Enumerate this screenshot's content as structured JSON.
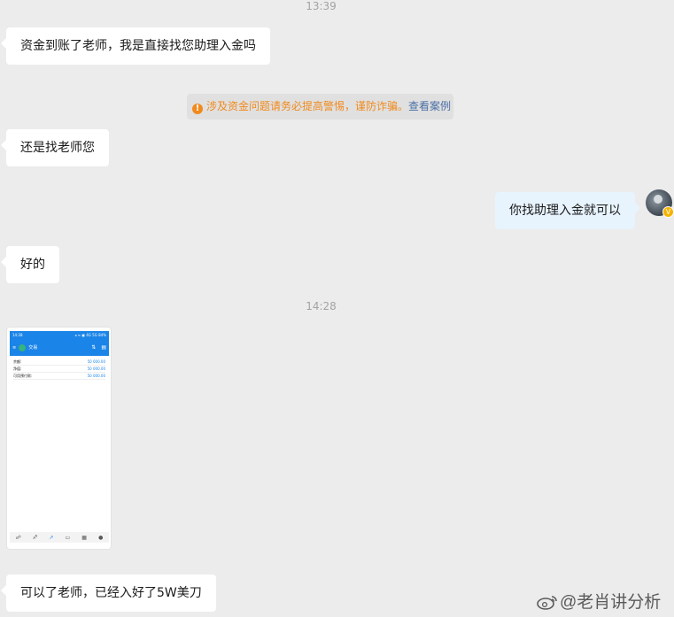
{
  "chat": {
    "timestamps": {
      "t1": "13:39",
      "t2": "14:28"
    },
    "messages": {
      "m1": "资金到账了老师，我是直接找您助理入金吗",
      "m2": "还是找老师您",
      "m3": "你找助理入金就可以",
      "m4": "好的",
      "m5": "可以了老师，已经入好了5W美刀"
    },
    "notice": {
      "icon": "warning-icon",
      "warning": "涉及资金问题请务必提高警惕，谨防诈骗。",
      "link": "查看案例",
      "color": "#f08a1c"
    },
    "avatar_badge": "V",
    "screenshot": {
      "status_left": "14:28",
      "status_right": "◂ ≡ ▣ 4G 5G 84%",
      "app_title": "交易",
      "rows": [
        {
          "label": "余额:",
          "value": "50 000.00"
        },
        {
          "label": "净值:",
          "value": "50 000.00"
        },
        {
          "label": "可用预付款:",
          "value": "50 000.00"
        }
      ],
      "tabs": [
        "☍",
        "♐",
        "↗",
        "▭",
        "▦",
        "●"
      ]
    }
  },
  "watermark": "@老肖讲分析"
}
